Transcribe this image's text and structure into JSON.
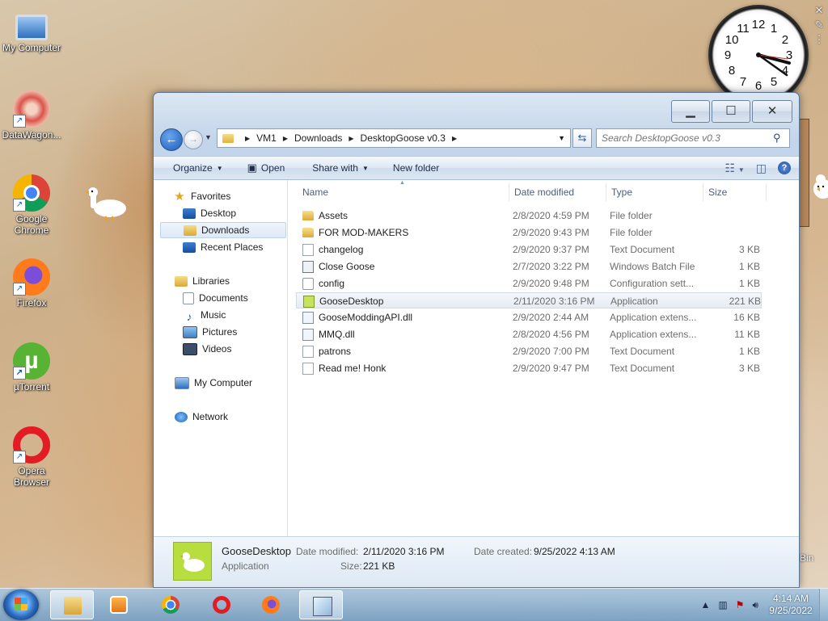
{
  "desktop": {
    "icons": [
      {
        "label": "My Computer",
        "icon": "computer-icon"
      },
      {
        "label": "DataWagon...",
        "icon": "datawagon-icon"
      },
      {
        "label": "Google Chrome",
        "icon": "chrome-icon"
      },
      {
        "label": "Firefox",
        "icon": "firefox-icon"
      },
      {
        "label": "µTorrent",
        "icon": "utorrent-icon"
      },
      {
        "label": "Opera Browser",
        "icon": "opera-icon"
      }
    ],
    "recycle_bin_partial": "Bin",
    "clock_numbers": [
      "12",
      "1",
      "2",
      "3",
      "4",
      "5",
      "6",
      "7",
      "8",
      "9",
      "10",
      "11"
    ]
  },
  "window": {
    "caption": {
      "minimize": "▭",
      "maximize": "☐",
      "close": "✕"
    },
    "address": {
      "crumbs": [
        "VM1",
        "Downloads",
        "DesktopGoose v0.3"
      ]
    },
    "search": {
      "placeholder": "Search DesktopGoose v0.3"
    },
    "toolbar": {
      "organize": "Organize",
      "open": "Open",
      "share_with": "Share with",
      "new_folder": "New folder"
    },
    "nav": {
      "favorites": "Favorites",
      "desktop": "Desktop",
      "downloads": "Downloads",
      "recent_places": "Recent Places",
      "libraries": "Libraries",
      "documents": "Documents",
      "music": "Music",
      "pictures": "Pictures",
      "videos": "Videos",
      "my_computer": "My Computer",
      "network": "Network"
    },
    "columns": {
      "name": "Name",
      "date": "Date modified",
      "type": "Type",
      "size": "Size"
    },
    "files": [
      {
        "name": "Assets",
        "date": "2/8/2020 4:59 PM",
        "type": "File folder",
        "size": "",
        "icon": "folder-icon"
      },
      {
        "name": "FOR MOD-MAKERS",
        "date": "2/9/2020 9:43 PM",
        "type": "File folder",
        "size": "",
        "icon": "folder-icon"
      },
      {
        "name": "changelog",
        "date": "2/9/2020 9:37 PM",
        "type": "Text Document",
        "size": "3 KB",
        "icon": "text-file-icon"
      },
      {
        "name": "Close Goose",
        "date": "2/7/2020 3:22 PM",
        "type": "Windows Batch File",
        "size": "1 KB",
        "icon": "batch-file-icon"
      },
      {
        "name": "config",
        "date": "2/9/2020 9:48 PM",
        "type": "Configuration sett...",
        "size": "1 KB",
        "icon": "config-file-icon"
      },
      {
        "name": "GooseDesktop",
        "date": "2/11/2020 3:16 PM",
        "type": "Application",
        "size": "221 KB",
        "icon": "application-icon"
      },
      {
        "name": "GooseModdingAPI.dll",
        "date": "2/9/2020 2:44 AM",
        "type": "Application extens...",
        "size": "16 KB",
        "icon": "dll-file-icon"
      },
      {
        "name": "MMQ.dll",
        "date": "2/8/2020 4:56 PM",
        "type": "Application extens...",
        "size": "11 KB",
        "icon": "dll-file-icon"
      },
      {
        "name": "patrons",
        "date": "2/9/2020 7:00 PM",
        "type": "Text Document",
        "size": "1 KB",
        "icon": "text-file-icon"
      },
      {
        "name": "Read me! Honk",
        "date": "2/9/2020 9:47 PM",
        "type": "Text Document",
        "size": "3 KB",
        "icon": "text-file-icon"
      }
    ],
    "details": {
      "name": "GooseDesktop",
      "type": "Application",
      "modified_label": "Date modified:",
      "modified_value": "2/11/2020 3:16 PM",
      "size_label": "Size:",
      "size_value": "221 KB",
      "created_label": "Date created:",
      "created_value": "9/25/2022 4:13 AM"
    }
  },
  "taskbar": {
    "time": "4:14 AM",
    "date": "9/25/2022",
    "apps": [
      "file-explorer-icon",
      "media-player-icon",
      "chrome-icon",
      "opera-icon",
      "firefox-icon",
      "notepad-icon"
    ]
  }
}
